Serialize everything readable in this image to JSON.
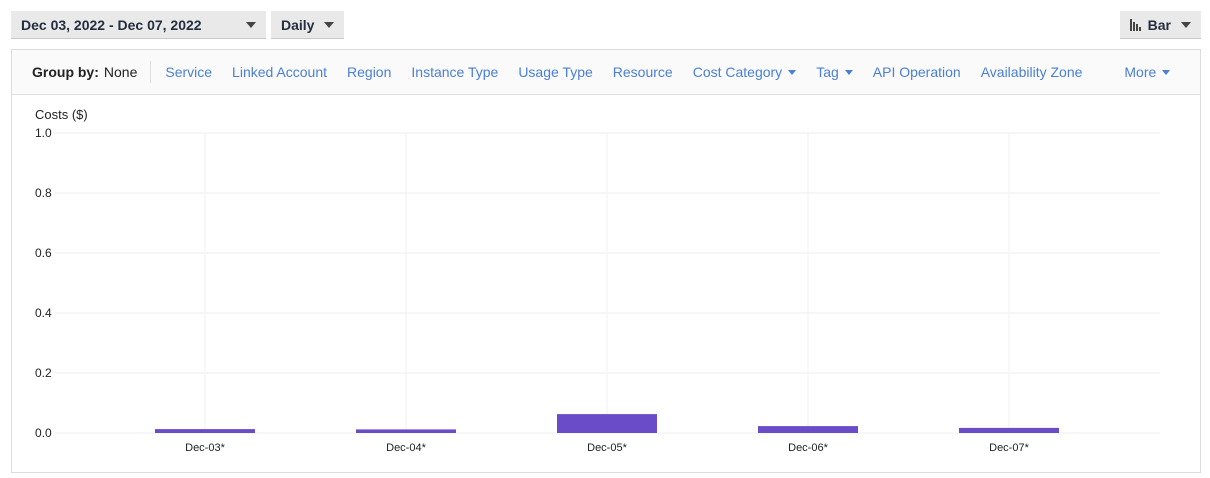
{
  "toolbar": {
    "date_range": "Dec 03, 2022 - Dec 07, 2022",
    "granularity": "Daily",
    "chart_type": "Bar"
  },
  "group_by": {
    "label": "Group by:",
    "value": "None",
    "options": [
      "Service",
      "Linked Account",
      "Region",
      "Instance Type",
      "Usage Type",
      "Resource",
      "Cost Category",
      "Tag",
      "API Operation",
      "Availability Zone"
    ],
    "more": "More"
  },
  "colors": {
    "bar": "#6a4cc8",
    "link": "#4a7fd6"
  },
  "chart_data": {
    "type": "bar",
    "ylabel": "Costs ($)",
    "ylim": [
      0,
      1.0
    ],
    "yticks": [
      "0.0",
      "0.2",
      "0.4",
      "0.6",
      "0.8",
      "1.0"
    ],
    "categories": [
      "Dec-03*",
      "Dec-04*",
      "Dec-05*",
      "Dec-06*",
      "Dec-07*"
    ],
    "values": [
      0.013,
      0.012,
      0.063,
      0.023,
      0.017
    ],
    "grid": true
  }
}
